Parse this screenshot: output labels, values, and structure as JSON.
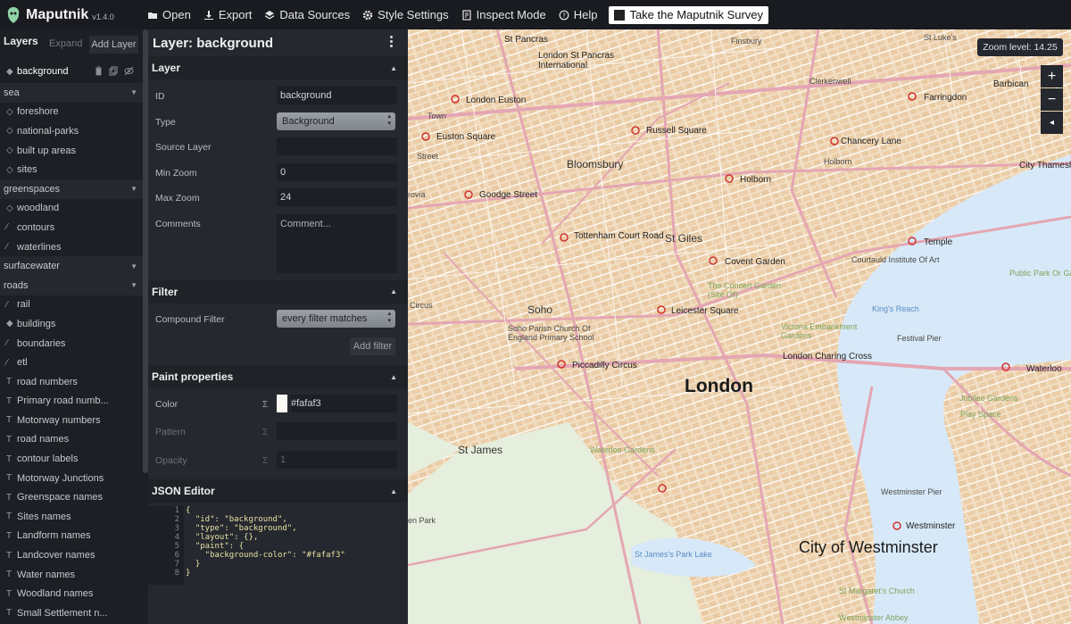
{
  "app": {
    "name": "Maputnik",
    "version": "v1.4.0"
  },
  "toolbar": {
    "items": [
      {
        "label": "Open",
        "icon": "folder-open-icon"
      },
      {
        "label": "Export",
        "icon": "download-icon"
      },
      {
        "label": "Data Sources",
        "icon": "layers-stack-icon"
      },
      {
        "label": "Style Settings",
        "icon": "gear-icon"
      },
      {
        "label": "Inspect Mode",
        "icon": "inspect-icon"
      },
      {
        "label": "Help",
        "icon": "help-circle-icon"
      }
    ],
    "survey_label": "Take the Maputnik Survey"
  },
  "layer_list": {
    "title": "Layers",
    "expand_label": "Expand",
    "add_label": "Add Layer",
    "selected": "background",
    "rows": [
      {
        "kind": "group",
        "label": "sea"
      },
      {
        "kind": "item",
        "label": "foreshore",
        "glyph": "◇"
      },
      {
        "kind": "item",
        "label": "national-parks",
        "glyph": "◇"
      },
      {
        "kind": "item",
        "label": "built up areas",
        "glyph": "◇"
      },
      {
        "kind": "item",
        "label": "sites",
        "glyph": "◇"
      },
      {
        "kind": "group",
        "label": "greenspaces"
      },
      {
        "kind": "item",
        "label": "woodland",
        "glyph": "◇"
      },
      {
        "kind": "item",
        "label": "contours",
        "glyph": "∕"
      },
      {
        "kind": "item",
        "label": "waterlines",
        "glyph": "∕"
      },
      {
        "kind": "group",
        "label": "surfacewater"
      },
      {
        "kind": "group",
        "label": "roads"
      },
      {
        "kind": "item",
        "label": "rail",
        "glyph": "∕"
      },
      {
        "kind": "item",
        "label": "buildings",
        "glyph": "◆"
      },
      {
        "kind": "item",
        "label": "boundaries",
        "glyph": "∕"
      },
      {
        "kind": "item",
        "label": "etl",
        "glyph": "∕"
      },
      {
        "kind": "item",
        "label": "road numbers",
        "glyph": "T"
      },
      {
        "kind": "item",
        "label": "Primary road numb...",
        "glyph": "T"
      },
      {
        "kind": "item",
        "label": "Motorway numbers",
        "glyph": "T"
      },
      {
        "kind": "item",
        "label": "road names",
        "glyph": "T"
      },
      {
        "kind": "item",
        "label": "contour labels",
        "glyph": "T"
      },
      {
        "kind": "item",
        "label": "Motorway Junctions",
        "glyph": "T"
      },
      {
        "kind": "item",
        "label": "Greenspace names",
        "glyph": "T"
      },
      {
        "kind": "item",
        "label": "Sites names",
        "glyph": "T"
      },
      {
        "kind": "item",
        "label": "Landform names",
        "glyph": "T"
      },
      {
        "kind": "item",
        "label": "Landcover names",
        "glyph": "T"
      },
      {
        "kind": "item",
        "label": "Water names",
        "glyph": "T"
      },
      {
        "kind": "item",
        "label": "Woodland names",
        "glyph": "T"
      },
      {
        "kind": "item",
        "label": "Small Settlement n...",
        "glyph": "T"
      }
    ]
  },
  "editor": {
    "title": "Layer: background",
    "layer_section": "Layer",
    "fields": {
      "id_label": "ID",
      "id_value": "background",
      "type_label": "Type",
      "type_value": "Background",
      "source_label": "Source Layer",
      "source_value": "",
      "minzoom_label": "Min Zoom",
      "minzoom_value": "0",
      "maxzoom_label": "Max Zoom",
      "maxzoom_value": "24",
      "comments_label": "Comments",
      "comments_placeholder": "Comment..."
    },
    "filter_section": "Filter",
    "compound_label": "Compound Filter",
    "compound_value": "every filter matches",
    "add_filter_label": "Add filter",
    "paint_section": "Paint properties",
    "paint": {
      "color_label": "Color",
      "color_value": "#fafaf3",
      "pattern_label": "Pattern",
      "pattern_value": "",
      "opacity_label": "Opacity",
      "opacity_value": "1"
    },
    "json_section": "JSON Editor",
    "json_lines": [
      "{",
      "  \"id\": \"background\",",
      "  \"type\": \"background\",",
      "  \"layout\": {},",
      "  \"paint\": {",
      "    \"background-color\": \"#fafaf3\"",
      "  }",
      "}"
    ]
  },
  "map": {
    "zoom_label": "Zoom level: 14.25",
    "controls": [
      "+",
      "−",
      "◂"
    ],
    "labels": {
      "st_pancras": "St Pancras",
      "london_st_pancras": "London St Pancras",
      "international": "International",
      "finsbury": "Finsbury",
      "st_lukes": "St Luke's",
      "clerkenwell": "Clerkenwell",
      "barbican": "Barbican",
      "farringdon": "Farringdon",
      "london_euston": "London Euston",
      "russell_square": "Russell Square",
      "euston_square": "Euston Square",
      "chancery_lane": "Chancery Lane",
      "city_thameslink": "City Thameslink",
      "bloomsbury": "Bloomsbury",
      "holborn_station": "Holborn",
      "holborn": "Holborn",
      "goodge_street": "Goodge Street",
      "tottenham_court_road": "Tottenham Court Road",
      "st_giles": "St Giles",
      "temple": "Temple",
      "covent_garden": "Covent Garden",
      "soho": "Soho",
      "leicester_square": "Leicester Square",
      "piccadilly_circus": "Piccadilly Circus",
      "london_charing_cross": "London Charing Cross",
      "london": "London",
      "waterloo": "Waterloo",
      "festival_pier": "Festival Pier",
      "st_james": "St James",
      "waterloo_gardens": "Waterloo Gardens",
      "westminster_pier": "Westminster Pier",
      "westminster": "Westminster",
      "city_of_westminster": "City of Westminster",
      "st_james_park_lake": "St James's Park Lake",
      "st_margarets_church": "St Margaret's Church",
      "westminster_abbey": "Westminster Abbey",
      "kings_reach": "King's Reach",
      "victoria_embankment": "Victoria Embankment Gardens",
      "jubilee_gardens": "Jubilee Gardens",
      "play_space": "Play Space",
      "public_park": "Public Park Or Garden",
      "en_park": "en Park",
      "circus": "Circus",
      "town": "Town",
      "street": "Street",
      "rovia": "rovia",
      "courtauld": "Courtauld Institute Of Art",
      "concert_garden": "The Concert Garden (Site Of)",
      "soho_parish": "Soho Parish Church Of England Primary School"
    }
  },
  "colors": {
    "toolbar_bg": "#191b20",
    "panel_bg": "#25282e",
    "list_bg": "#1c1f24",
    "map_land": "#f2dfc4",
    "map_water": "#d7e9f8",
    "map_road": "#e4a6b3",
    "map_park": "#c9dfb2"
  }
}
